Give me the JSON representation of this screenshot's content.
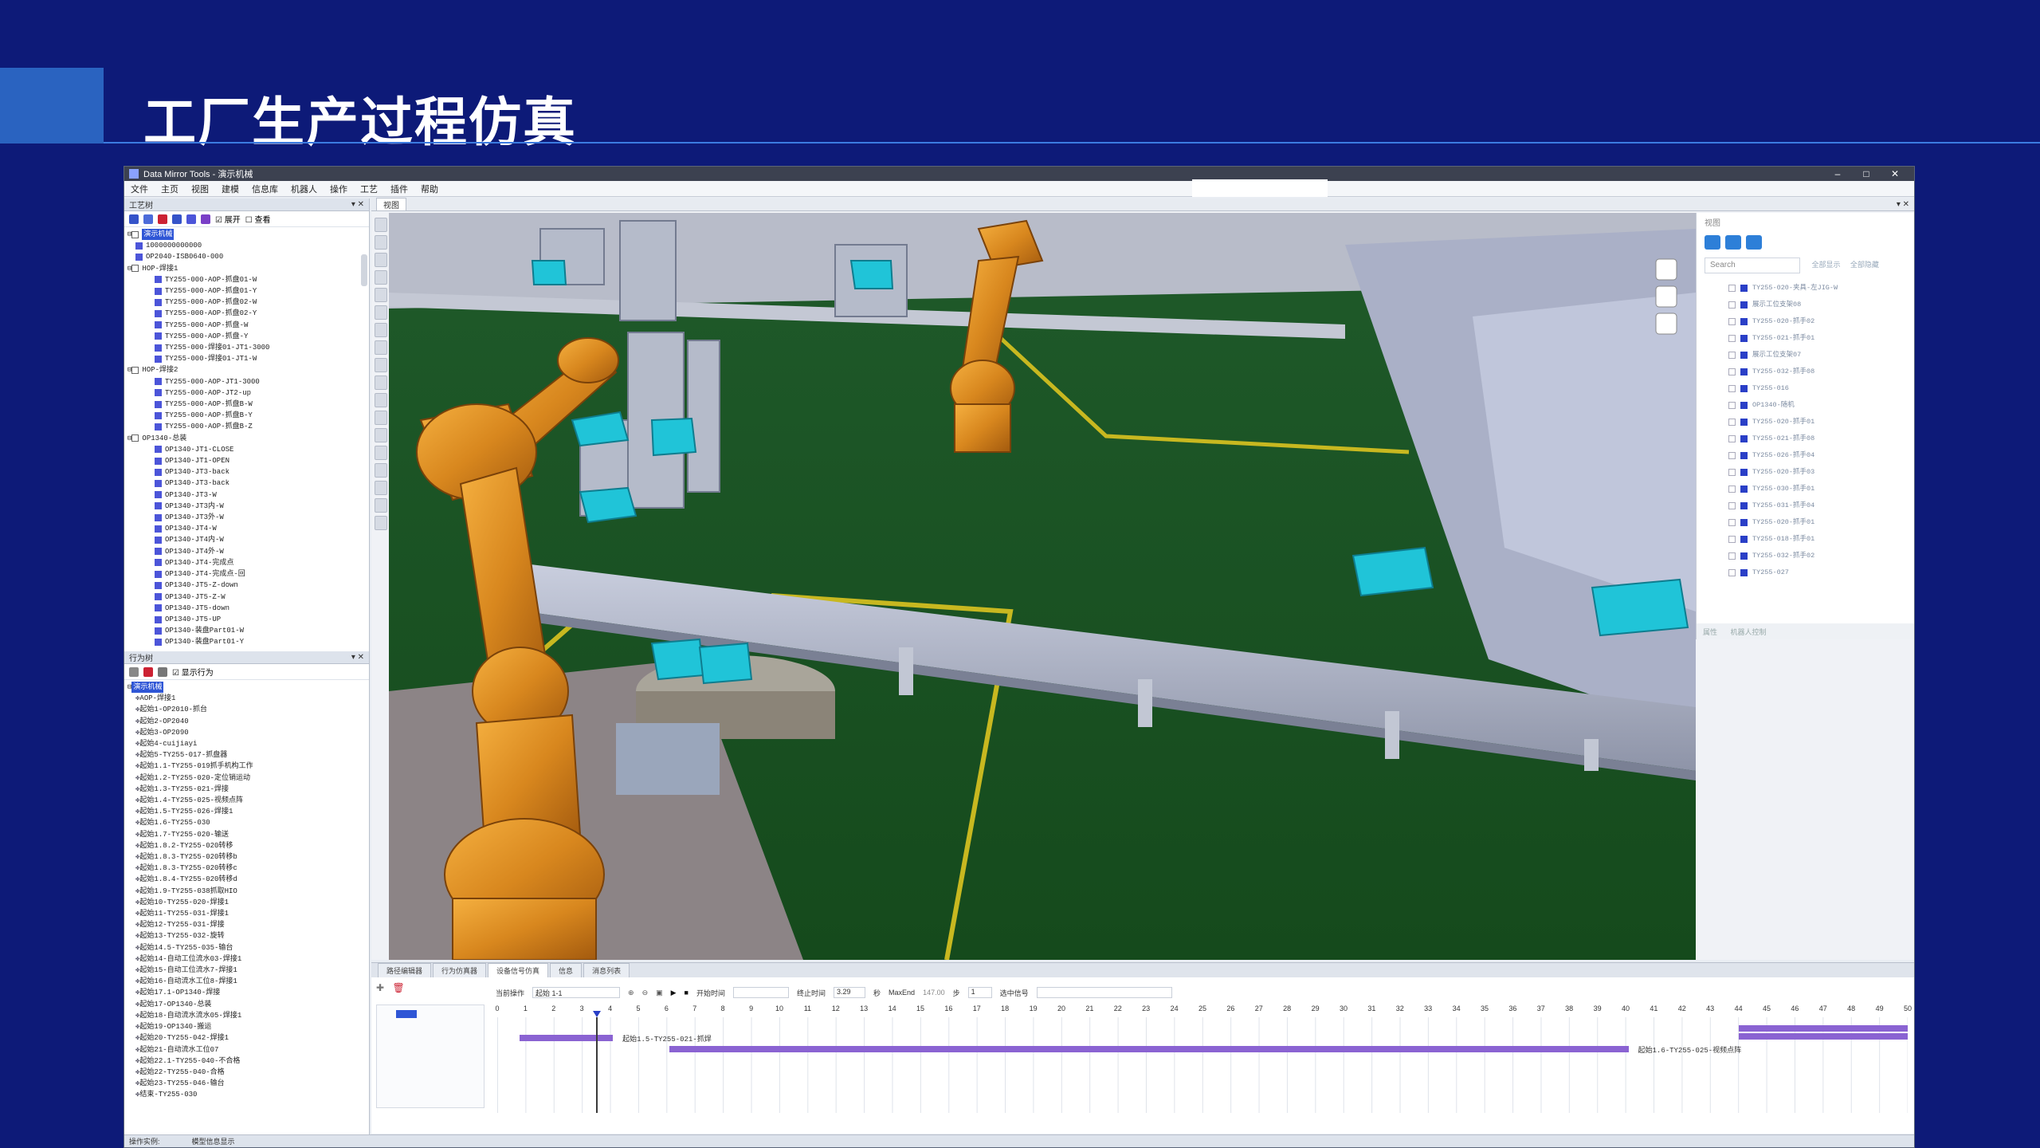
{
  "slide": {
    "title": "工厂生产过程仿真"
  },
  "window": {
    "title": "Data Mirror Tools - 演示机械",
    "controls": [
      "–",
      "□",
      "✕"
    ]
  },
  "menu": [
    "文件",
    "主页",
    "视图",
    "建模",
    "信息库",
    "机器人",
    "操作",
    "工艺",
    "插件",
    "帮助"
  ],
  "process_panel": {
    "title": "工艺树",
    "options": [
      "展开",
      "查看"
    ],
    "selected": "演示机械",
    "rows": [
      {
        "level": 1,
        "mk": "bl",
        "text": "1000000000000"
      },
      {
        "level": 1,
        "mk": "bl",
        "text": "OP2040-ISB0640-000"
      },
      {
        "level": 0,
        "mk": "",
        "text": "HOP-焊接1"
      },
      {
        "level": 2,
        "mk": "bl",
        "text": "TY255-000-AOP-抓盘01-W"
      },
      {
        "level": 2,
        "mk": "bl",
        "text": "TY255-000-AOP-抓盘01-Y"
      },
      {
        "level": 2,
        "mk": "bl",
        "text": "TY255-000-AOP-抓盘02-W"
      },
      {
        "level": 2,
        "mk": "bl",
        "text": "TY255-000-AOP-抓盘02-Y"
      },
      {
        "level": 2,
        "mk": "bl",
        "text": "TY255-000-AOP-抓盘-W"
      },
      {
        "level": 2,
        "mk": "bl",
        "text": "TY255-000-AOP-抓盘-Y"
      },
      {
        "level": 2,
        "mk": "bl",
        "text": "TY255-000-焊接01-JT1-3000"
      },
      {
        "level": 2,
        "mk": "bl",
        "text": "TY255-000-焊接01-JT1-W"
      },
      {
        "level": 0,
        "mk": "",
        "text": "HOP-焊接2"
      },
      {
        "level": 2,
        "mk": "bl",
        "text": "TY255-000-AOP-JT1-3000"
      },
      {
        "level": 2,
        "mk": "bl",
        "text": "TY255-000-AOP-JT2-up"
      },
      {
        "level": 2,
        "mk": "bl",
        "text": "TY255-000-AOP-抓盘B-W"
      },
      {
        "level": 2,
        "mk": "bl",
        "text": "TY255-000-AOP-抓盘B-Y"
      },
      {
        "level": 2,
        "mk": "bl",
        "text": "TY255-000-AOP-抓盘B-Z"
      },
      {
        "level": 0,
        "mk": "",
        "text": "OP1340-总装"
      },
      {
        "level": 2,
        "mk": "bl",
        "text": "OP1340-JT1-CLOSE"
      },
      {
        "level": 2,
        "mk": "bl",
        "text": "OP1340-JT1-OPEN"
      },
      {
        "level": 2,
        "mk": "bl",
        "text": "OP1340-JT3-back"
      },
      {
        "level": 2,
        "mk": "bl",
        "text": "OP1340-JT3-back"
      },
      {
        "level": 2,
        "mk": "bl",
        "text": "OP1340-JT3-W"
      },
      {
        "level": 2,
        "mk": "bl",
        "text": "OP1340-JT3内-W"
      },
      {
        "level": 2,
        "mk": "bl",
        "text": "OP1340-JT3外-W"
      },
      {
        "level": 2,
        "mk": "bl",
        "text": "OP1340-JT4-W"
      },
      {
        "level": 2,
        "mk": "bl",
        "text": "OP1340-JT4内-W"
      },
      {
        "level": 2,
        "mk": "bl",
        "text": "OP1340-JT4外-W"
      },
      {
        "level": 2,
        "mk": "bl",
        "text": "OP1340-JT4-完成点"
      },
      {
        "level": 2,
        "mk": "bl",
        "text": "OP1340-JT4-完成点-回"
      },
      {
        "level": 2,
        "mk": "bl",
        "text": "OP1340-JT5-Z-down"
      },
      {
        "level": 2,
        "mk": "bl",
        "text": "OP1340-JT5-Z-W"
      },
      {
        "level": 2,
        "mk": "bl",
        "text": "OP1340-JT5-down"
      },
      {
        "level": 2,
        "mk": "bl",
        "text": "OP1340-JT5-UP"
      },
      {
        "level": 2,
        "mk": "bl",
        "text": "OP1340-装盘Part01-W"
      },
      {
        "level": 2,
        "mk": "bl",
        "text": "OP1340-装盘Part01-Y"
      }
    ]
  },
  "behavior_panel": {
    "title": "行为树",
    "option": "显示行为",
    "selected": "演示机械",
    "rows": [
      "AOP-焊接1",
      "起始1-OP2010-抓台",
      "起始2-OP2040",
      "起始3-OP2090",
      "起始4-cuijiayi",
      "起始5-TY255-017-抓盘器",
      "起始1.1-TY255-019抓手机构工作",
      "起始1.2-TY255-020-定位销运动",
      "起始1.3-TY255-021-焊接",
      "起始1.4-TY255-025-视频点阵",
      "起始1.5-TY255-026-焊接1",
      "起始1.6-TY255-030",
      "起始1.7-TY255-020-输送",
      "起始1.8.2-TY255-020转移",
      "起始1.8.3-TY255-020转移b",
      "起始1.8.3-TY255-020转移c",
      "起始1.8.4-TY255-020转移d",
      "起始1.9-TY255-038抓取HIO",
      "起始10-TY255-020-焊接1",
      "起始11-TY255-031-焊接1",
      "起始12-TY255-031-焊接",
      "起始13-TY255-032-旋转",
      "起始14.5-TY255-035-输台",
      "起始14-自动工位流水03-焊接1",
      "起始15-自动工位流水7-焊接1",
      "起始16-自动流水工位8-焊接1",
      "起始17.1-OP1340-焊接",
      "起始17-OP1340-总装",
      "起始18-自动流水流水05-焊接1",
      "起始19-OP1340-搬运",
      "起始20-TY255-042-焊接1",
      "起始21-自动流水工位07",
      "起始22.1-TY255-040-不合格",
      "起始22-TY255-040-合格",
      "起始23-TY255-046-输台",
      "结束-TY255-030"
    ]
  },
  "viewport": {
    "tab": "视图"
  },
  "right_panel": {
    "header": "视图",
    "search_placeholder": "Search",
    "tabs": [
      "全部显示",
      "全部隐藏"
    ],
    "items": [
      "TY255-020-夹具-左JIG-W",
      "展示工位支架08",
      "TY255-020-抓手02",
      "TY255-021-抓手01",
      "展示工位支架07",
      "TY255-032-抓手08",
      "TY255-016",
      "OP1340-随机",
      "TY255-020-抓手01",
      "TY255-021-抓手08",
      "TY255-026-抓手04",
      "TY255-020-抓手03",
      "TY255-030-抓手01",
      "TY255-031-抓手04",
      "TY255-020-抓手01",
      "TY255-018-抓手01",
      "TY255-032-抓手02",
      "TY255-027"
    ],
    "footer": [
      "属性",
      "机器人控制"
    ]
  },
  "timeline": {
    "tabs": [
      "路径编辑器",
      "行为仿真器",
      "设备信号仿真",
      "信息",
      "消息列表"
    ],
    "active_tab": 2,
    "controls": {
      "current_op_label": "当前操作",
      "current_op_value": "起始 1-1",
      "start_label": "开始时间",
      "end_label": "终止时间",
      "end_value": "3.29",
      "seconds": "秒",
      "maxend_label": "MaxEnd",
      "maxend_value": "147.00",
      "step_label": "步",
      "step_value": "1",
      "signal_label": "选中信号"
    },
    "ruler_start": 0,
    "ruler_end": 50,
    "cursor_time": 3.5,
    "bars": [
      {
        "start": 0.8,
        "end": 4.1,
        "lane": 0,
        "label": "起始1.5-TY255-021-抓焊"
      },
      {
        "start": 6.1,
        "end": 40.1,
        "lane": 1,
        "label": "起始1.6-TY255-025-视频点阵"
      },
      {
        "start": 44.0,
        "end": 50,
        "lane": -1,
        "label": ""
      },
      {
        "start": 44.0,
        "end": 50,
        "lane": -2,
        "label": ""
      }
    ]
  },
  "status": {
    "label": "操作实例:",
    "value": "模型信息显示"
  }
}
